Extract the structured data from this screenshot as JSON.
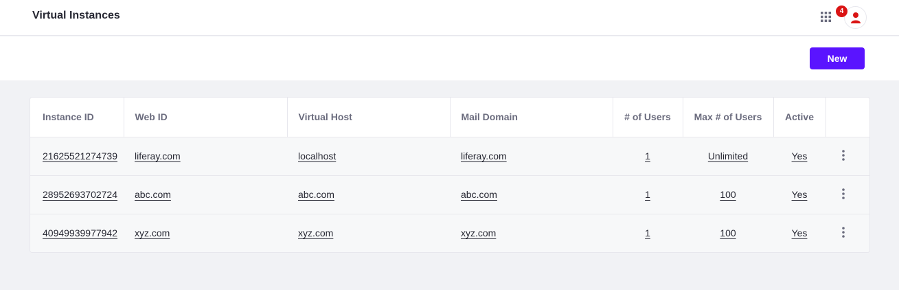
{
  "header": {
    "title": "Virtual Instances",
    "notification_count": "4"
  },
  "toolbar": {
    "new_label": "New"
  },
  "table": {
    "columns": {
      "instance_id": "Instance ID",
      "web_id": "Web ID",
      "virtual_host": "Virtual Host",
      "mail_domain": "Mail Domain",
      "users": "# of Users",
      "max_users": "Max # of Users",
      "active": "Active"
    },
    "rows": [
      {
        "instance_id": "21625521274739",
        "web_id": "liferay.com",
        "virtual_host": "localhost",
        "mail_domain": "liferay.com",
        "users": "1",
        "max_users": "Unlimited",
        "active": "Yes"
      },
      {
        "instance_id": "28952693702724",
        "web_id": "abc.com",
        "virtual_host": "abc.com",
        "mail_domain": "abc.com",
        "users": "1",
        "max_users": "100",
        "active": "Yes"
      },
      {
        "instance_id": "40949939977942",
        "web_id": "xyz.com",
        "virtual_host": "xyz.com",
        "mail_domain": "xyz.com",
        "users": "1",
        "max_users": "100",
        "active": "Yes"
      }
    ]
  },
  "colors": {
    "accent": "#5a14ff",
    "badge": "#da1414",
    "avatar_icon": "#da1414"
  },
  "icons": {
    "apps": "grid-icon",
    "user": "user-icon",
    "row_actions": "kebab-icon"
  }
}
